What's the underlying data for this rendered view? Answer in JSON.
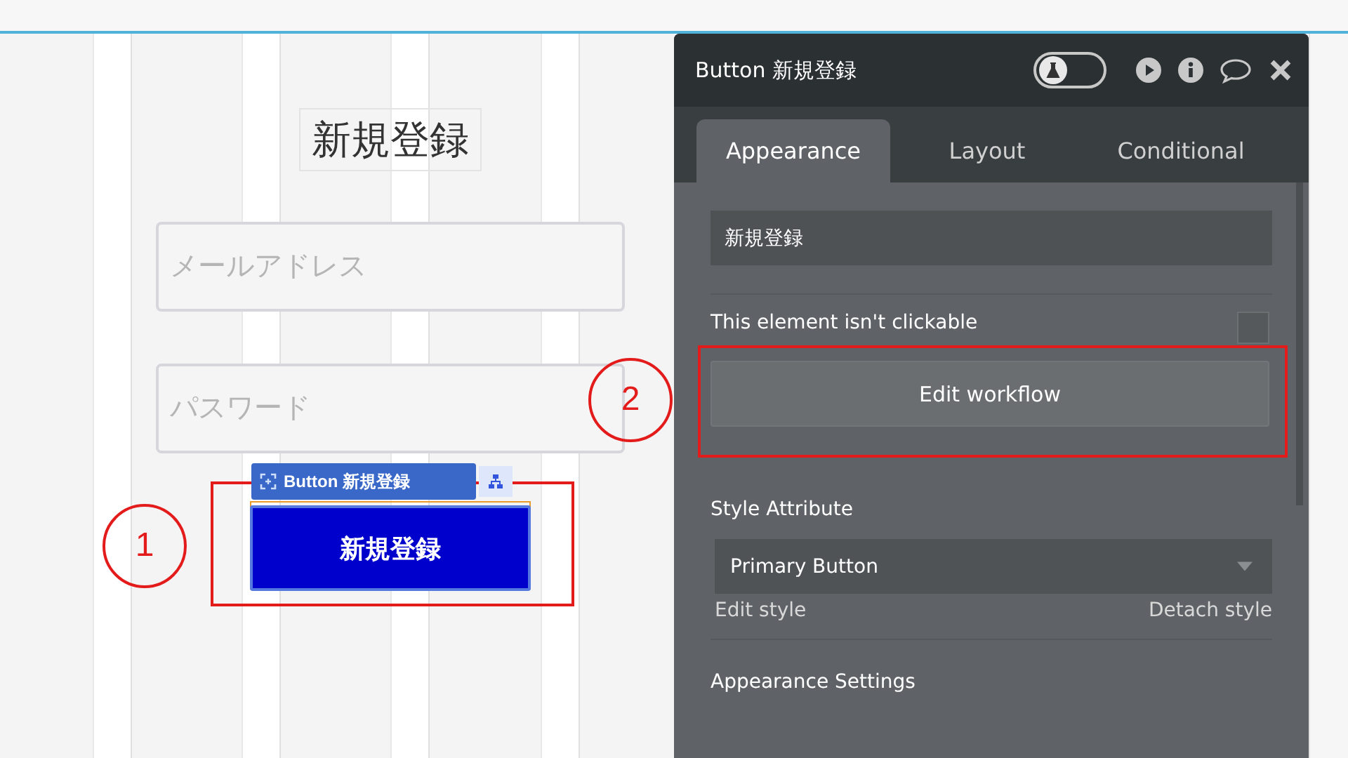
{
  "canvas": {
    "heading": "新規登録",
    "fields": [
      {
        "placeholder": "メールアドレス"
      },
      {
        "placeholder": "パスワード"
      }
    ],
    "selection_label": "Button 新規登録",
    "button": "新規登録"
  },
  "panel": {
    "title": "Button 新規登録",
    "toggle": {
      "on": false
    },
    "tabs": [
      {
        "label": "Appearance",
        "selected": true
      },
      {
        "label": "Layout",
        "selected": false
      },
      {
        "label": "Conditional",
        "selected": false
      }
    ],
    "text_value": "新規登録",
    "clickable_label": "This element isn't clickable",
    "not_clickable": {
      "checked": false
    },
    "edit_workflow": "Edit workflow",
    "style_section": "Style Attribute",
    "style_value": "Primary Button",
    "edit_style": "Edit style",
    "detach_style": "Detach style",
    "appearance_settings": "Appearance Settings"
  },
  "annotations": [
    {
      "number": "1"
    },
    {
      "number": "2"
    }
  ]
}
